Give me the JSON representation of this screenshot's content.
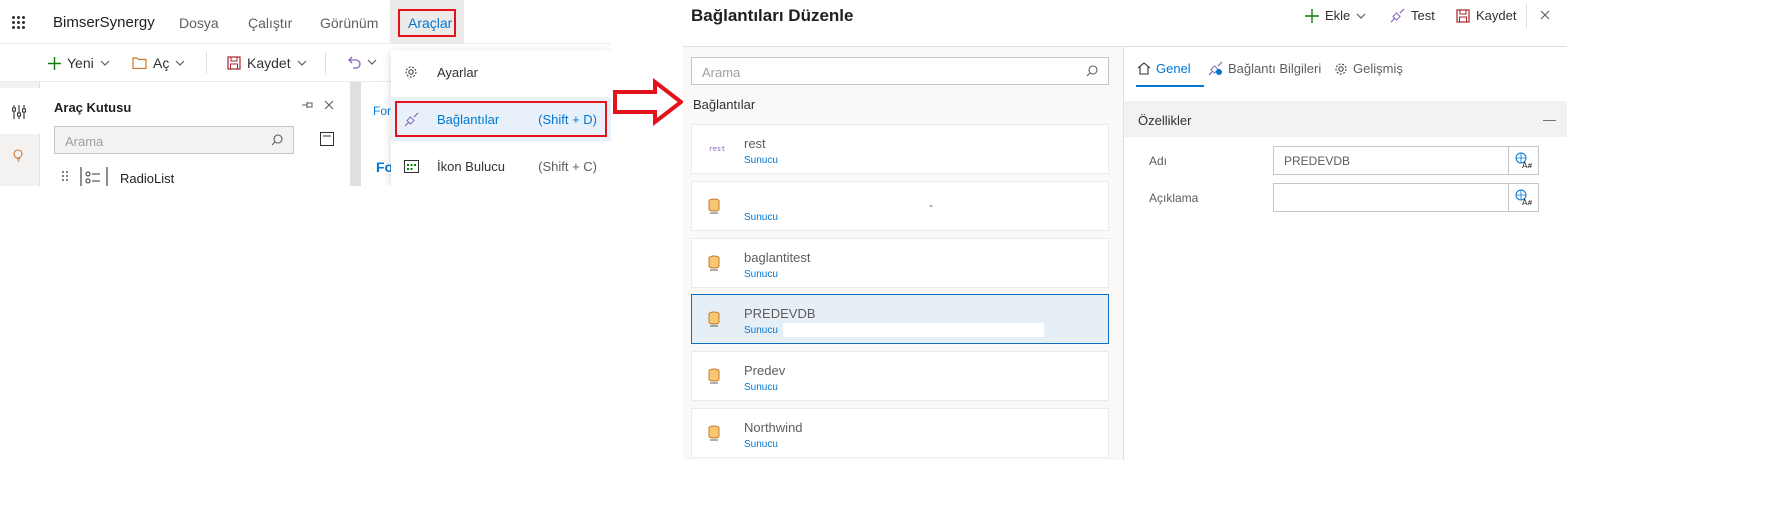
{
  "left": {
    "app_title": "BimserSynergy",
    "menu": [
      "Dosya",
      "Çalıştır",
      "Görünüm",
      "Araçlar"
    ],
    "toolbar": {
      "new": "Yeni",
      "open": "Aç",
      "save": "Kaydet"
    },
    "toolbox": {
      "title": "Araç Kutusu",
      "search_placeholder": "Arama",
      "item": "RadioList"
    },
    "form_tab": "For",
    "form_heading": "Fo",
    "dropdown": [
      {
        "label": "Ayarlar",
        "shortcut": ""
      },
      {
        "label": "Bağlantılar",
        "shortcut": "(Shift + D)"
      },
      {
        "label": "İkon Bulucu",
        "shortcut": "(Shift + C)"
      }
    ],
    "colors": {
      "highlight": "#e3131c",
      "accent": "#0078d4"
    }
  },
  "right": {
    "title": "Bağlantıları Düzenle",
    "actions": {
      "add": "Ekle",
      "test": "Test",
      "save": "Kaydet"
    },
    "search_placeholder": "Arama",
    "section": "Bağlantılar",
    "connections": [
      {
        "name": "rest",
        "type": "Sunucu",
        "icon": "rest-icon"
      },
      {
        "name": "",
        "type": "Sunucu",
        "icon": "database-icon",
        "extra": "-"
      },
      {
        "name": "baglantitest",
        "type": "Sunucu",
        "icon": "database-icon"
      },
      {
        "name": "PREDEVDB",
        "type": "Sunucu",
        "icon": "database-icon",
        "selected": true
      },
      {
        "name": "Predev",
        "type": "Sunucu",
        "icon": "database-icon"
      },
      {
        "name": "Northwind",
        "type": "Sunucu",
        "icon": "database-icon"
      }
    ],
    "tabs": {
      "general": "Genel",
      "connection_info": "Bağlantı Bilgileri",
      "advanced": "Gelişmiş"
    },
    "properties": {
      "title": "Özellikler",
      "name_label": "Adı",
      "name_value": "PREDEVDB",
      "desc_label": "Açıklama",
      "desc_value": ""
    }
  }
}
